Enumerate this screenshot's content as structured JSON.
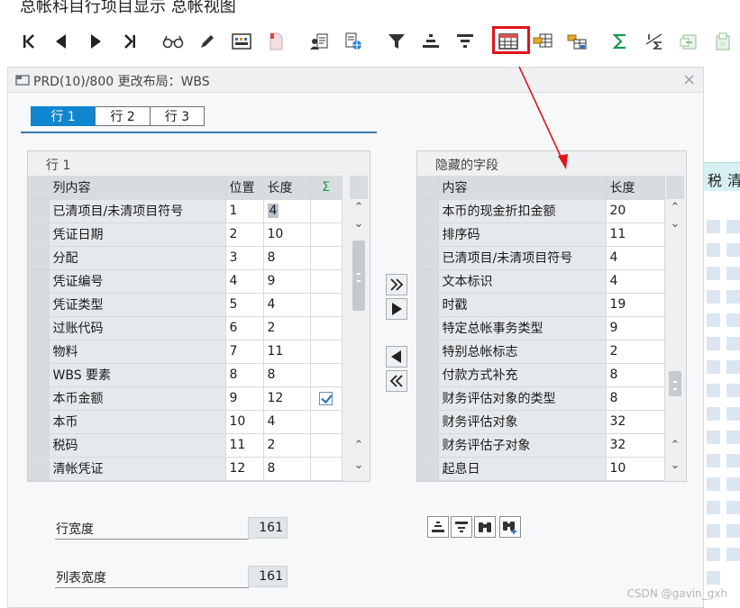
{
  "app_title": "总帐科目行项目显示 总帐视图",
  "toolbar": {
    "buttons": [
      {
        "name": "first-page-button",
        "icon": "first-page-icon"
      },
      {
        "name": "previous-page-button",
        "icon": "previous-icon"
      },
      {
        "name": "next-page-button",
        "icon": "next-icon"
      },
      {
        "name": "last-page-button",
        "icon": "last-page-icon"
      },
      {
        "name": "display-button",
        "icon": "glasses-icon"
      },
      {
        "name": "edit-button",
        "icon": "pencil-icon"
      },
      {
        "name": "settings-button",
        "icon": "settings-icon"
      },
      {
        "name": "document-button",
        "icon": "document-icon"
      },
      {
        "name": "user-button",
        "icon": "user-icon"
      },
      {
        "name": "web-button",
        "icon": "globe-icon"
      },
      {
        "name": "filter-button",
        "icon": "filter-icon"
      },
      {
        "name": "sort-ascending-button",
        "icon": "sort-ascending-icon"
      },
      {
        "name": "sort-descending-button",
        "icon": "sort-descending-icon"
      },
      {
        "name": "change-layout-button",
        "icon": "layout-grid-icon"
      },
      {
        "name": "select-layout-button",
        "icon": "layout-select-icon"
      },
      {
        "name": "save-layout-button",
        "icon": "layout-save-icon"
      },
      {
        "name": "total-button",
        "icon": "sigma-icon"
      },
      {
        "name": "subtotal-button",
        "icon": "subtotal-icon"
      },
      {
        "name": "export-button",
        "icon": "export-icon"
      },
      {
        "name": "import-button",
        "icon": "import-icon"
      }
    ]
  },
  "dialog": {
    "title": "PRD(10)/800 更改布局：WBS",
    "close_symbol": "×",
    "tabs": [
      {
        "label": "行 1",
        "active": true
      },
      {
        "label": "行 2",
        "active": false
      },
      {
        "label": "行 3",
        "active": false
      }
    ],
    "left_panel": {
      "title": "行 1",
      "headers": {
        "content": "列内容",
        "position": "位置",
        "length": "长度",
        "sum": "Σ"
      },
      "rows": [
        {
          "content": "已清项目/未清项目符号",
          "position": "1",
          "length": "4",
          "sum": false
        },
        {
          "content": "凭证日期",
          "position": "2",
          "length": "10",
          "sum": false
        },
        {
          "content": "分配",
          "position": "3",
          "length": "8",
          "sum": false
        },
        {
          "content": "凭证编号",
          "position": "4",
          "length": "9",
          "sum": false
        },
        {
          "content": "凭证类型",
          "position": "5",
          "length": "4",
          "sum": false
        },
        {
          "content": "过账代码",
          "position": "6",
          "length": "2",
          "sum": false
        },
        {
          "content": "物料",
          "position": "7",
          "length": "11",
          "sum": false
        },
        {
          "content": "WBS 要素",
          "position": "8",
          "length": "8",
          "sum": false
        },
        {
          "content": "本币金额",
          "position": "9",
          "length": "12",
          "sum": true
        },
        {
          "content": "本币",
          "position": "10",
          "length": "4",
          "sum": false
        },
        {
          "content": "税码",
          "position": "11",
          "length": "2",
          "sum": false
        },
        {
          "content": "清帐凭证",
          "position": "12",
          "length": "8",
          "sum": false
        }
      ]
    },
    "right_panel": {
      "title": "隐藏的字段",
      "headers": {
        "content": "内容",
        "length": "长度"
      },
      "rows": [
        {
          "content": "本币的现金折扣金额",
          "length": "20"
        },
        {
          "content": "排序码",
          "length": "11"
        },
        {
          "content": "已清项目/未清项目符号",
          "length": "4"
        },
        {
          "content": "文本标识",
          "length": "4"
        },
        {
          "content": "时戳",
          "length": "19"
        },
        {
          "content": "特定总帐事务类型",
          "length": "9"
        },
        {
          "content": "特别总帐标志",
          "length": "2"
        },
        {
          "content": "付款方式补充",
          "length": "8"
        },
        {
          "content": "财务评估对象的类型",
          "length": "8"
        },
        {
          "content": "财务评估对象",
          "length": "32"
        },
        {
          "content": "财务评估子对象",
          "length": "32"
        },
        {
          "content": "起息日",
          "length": "10"
        }
      ]
    },
    "row_width": {
      "label": "行宽度",
      "value": "161"
    },
    "list_width": {
      "label": "列表宽度",
      "value": "161"
    }
  },
  "background_grid": {
    "headers": [
      "税",
      "清"
    ]
  },
  "watermark": "CSDN @gavin_gxh",
  "colors": {
    "accent": "#0f86cf",
    "highlight_box": "#e0141b",
    "arrow": "#e0141b",
    "sum_icon": "#1a9a4a"
  }
}
